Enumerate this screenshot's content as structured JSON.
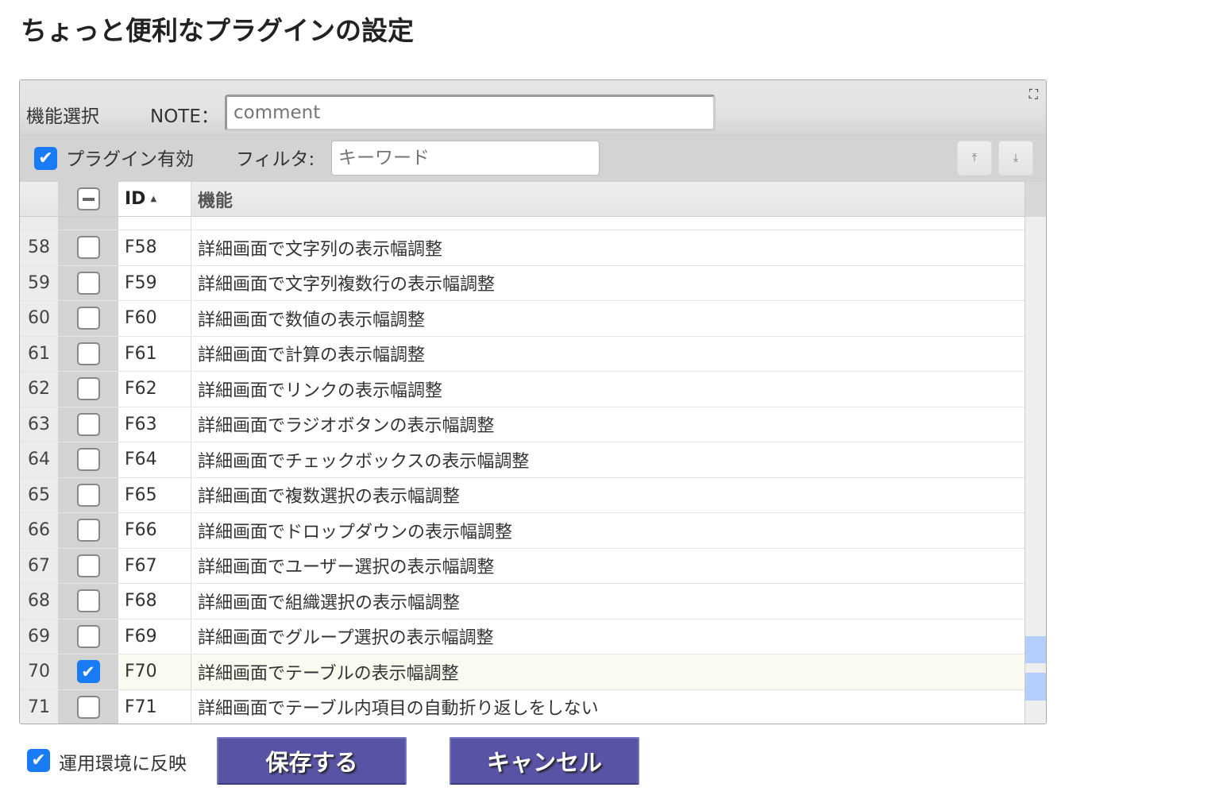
{
  "page_title": "ちょっと便利なプラグインの設定",
  "toolbar": {
    "section_label": "機能選択",
    "note_label": "NOTE：",
    "note_placeholder": "comment",
    "plugin_enabled_label": "プラグイン有効",
    "plugin_enabled": true,
    "filter_label": "フィルタ:",
    "filter_placeholder": "キーワード",
    "move_top_icon": "arrow-to-top",
    "move_bottom_icon": "arrow-to-bottom",
    "expand_icon": "expand"
  },
  "table": {
    "columns": [
      "",
      "",
      "ID",
      "機能"
    ],
    "sort_indicator": "▲",
    "rows": [
      {
        "no": "58",
        "id": "F58",
        "name": "詳細画面で文字列の表示幅調整",
        "checked": false
      },
      {
        "no": "59",
        "id": "F59",
        "name": "詳細画面で文字列複数行の表示幅調整",
        "checked": false
      },
      {
        "no": "60",
        "id": "F60",
        "name": "詳細画面で数値の表示幅調整",
        "checked": false
      },
      {
        "no": "61",
        "id": "F61",
        "name": "詳細画面で計算の表示幅調整",
        "checked": false
      },
      {
        "no": "62",
        "id": "F62",
        "name": "詳細画面でリンクの表示幅調整",
        "checked": false
      },
      {
        "no": "63",
        "id": "F63",
        "name": "詳細画面でラジオボタンの表示幅調整",
        "checked": false
      },
      {
        "no": "64",
        "id": "F64",
        "name": "詳細画面でチェックボックスの表示幅調整",
        "checked": false
      },
      {
        "no": "65",
        "id": "F65",
        "name": "詳細画面で複数選択の表示幅調整",
        "checked": false
      },
      {
        "no": "66",
        "id": "F66",
        "name": "詳細画面でドロップダウンの表示幅調整",
        "checked": false
      },
      {
        "no": "67",
        "id": "F67",
        "name": "詳細画面でユーザー選択の表示幅調整",
        "checked": false
      },
      {
        "no": "68",
        "id": "F68",
        "name": "詳細画面で組織選択の表示幅調整",
        "checked": false
      },
      {
        "no": "69",
        "id": "F69",
        "name": "詳細画面でグループ選択の表示幅調整",
        "checked": false
      },
      {
        "no": "70",
        "id": "F70",
        "name": "詳細画面でテーブルの表示幅調整",
        "checked": true
      },
      {
        "no": "71",
        "id": "F71",
        "name": "詳細画面でテーブル内項目の自動折り返しをしない",
        "checked": false
      }
    ]
  },
  "footer": {
    "apply_label": "運用環境に反映",
    "apply_checked": true,
    "save_label": "保存する",
    "cancel_label": "キャンセル"
  },
  "colors": {
    "accent": "#1a7cf4",
    "button": "#5853a4",
    "scroll_mark": "#b3cefb",
    "selected_row": "#fafaf0"
  }
}
